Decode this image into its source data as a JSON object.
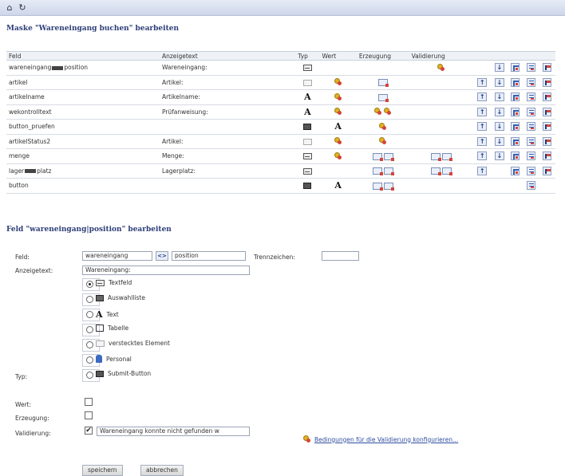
{
  "header": {
    "title": "Maske \"Wareneingang buchen\" bearbeiten"
  },
  "table": {
    "columns": [
      "Feld",
      "Anzeigetext",
      "Typ",
      "Wert",
      "Erzeugung",
      "Validierung"
    ],
    "rows": [
      {
        "feld_a": "wareneingang",
        "feld_b": "position",
        "anzeige": "Wareneingang:",
        "typ": "textfeld",
        "wert": "",
        "erzeugung": [],
        "validierung": [
          "cfg"
        ],
        "up": false,
        "down": true
      },
      {
        "feld_a": "artikel",
        "feld_b": "",
        "anzeige": "Artikel:",
        "typ": "versteckt",
        "wert": "cfg",
        "erzeugung": [
          "flag"
        ],
        "validierung": [],
        "up": true,
        "down": true
      },
      {
        "feld_a": "artikelname",
        "feld_b": "",
        "anzeige": "Artikelname:",
        "typ": "text",
        "wert": "cfg",
        "erzeugung": [
          "flag"
        ],
        "validierung": [],
        "up": true,
        "down": true
      },
      {
        "feld_a": "wekontrolltext",
        "feld_b": "",
        "anzeige": "Prüfanweisung:",
        "typ": "text",
        "wert": "cfg",
        "erzeugung": [
          "cfg",
          "cfg"
        ],
        "validierung": [],
        "up": true,
        "down": true
      },
      {
        "feld_a": "button_pruefen",
        "feld_b": "",
        "anzeige": "",
        "typ": "submit",
        "wert": "text",
        "erzeugung": [
          "cfg"
        ],
        "validierung": [],
        "up": true,
        "down": true
      },
      {
        "feld_a": "artikelStatus2",
        "feld_b": "",
        "anzeige": "Artikel:",
        "typ": "versteckt",
        "wert": "cfg",
        "erzeugung": [
          "cfg"
        ],
        "validierung": [],
        "up": true,
        "down": true
      },
      {
        "feld_a": "menge",
        "feld_b": "",
        "anzeige": "Menge:",
        "typ": "textfeld",
        "wert": "cfg",
        "erzeugung": [
          "flag",
          "flag"
        ],
        "validierung": [
          "flag",
          "flag"
        ],
        "up": true,
        "down": true
      },
      {
        "feld_a": "lager",
        "feld_b": "platz",
        "anzeige": "Lagerplatz:",
        "typ": "textfeld",
        "wert": "",
        "erzeugung": [
          "flag",
          "flag"
        ],
        "validierung": [
          "flag",
          "flag"
        ],
        "up": true,
        "down": false
      },
      {
        "feld_a": "button",
        "feld_b": "",
        "anzeige": "",
        "typ": "submit",
        "wert": "text",
        "erzeugung": [
          "flag",
          "flag"
        ],
        "validierung": [],
        "up": false,
        "down": false
      }
    ]
  },
  "form": {
    "title": "Feld \"wareneingang|position\" bearbeiten",
    "feld_label": "Feld:",
    "feld_part1": "wareneingang",
    "feld_sep_button": "<>",
    "feld_part2": "position",
    "trenn_label": "Trennzeichen:",
    "trenn_value": "",
    "anzeige_label": "Anzeigetext:",
    "anzeige_value": "Wareneingang:",
    "typ_label": "Typ:",
    "typ_options": [
      "Textfeld",
      "Auswahlliste",
      "Text",
      "Tabelle",
      "verstecktes Element",
      "Personal",
      "Submit-Button"
    ],
    "typ_selected": "Textfeld",
    "wert_label": "Wert:",
    "erzeugung_label": "Erzeugung:",
    "validierung_label": "Validierung:",
    "validierung_checked": "✔",
    "validierung_value": "Wareneingang konnte nicht gefunden w",
    "validierung_link": "Bedingungen für die Validierung konfigurieren...",
    "save_label": "speichern",
    "cancel_label": "abbrechen"
  }
}
